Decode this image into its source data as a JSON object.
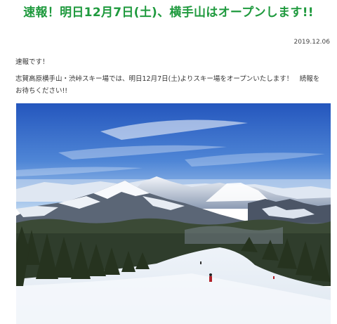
{
  "article": {
    "title": "速報！明日12月7日(土)、横手山はオープンします!!",
    "date": "2019.12.06",
    "lead": "速報です！",
    "body": "志賀高原横手山・渋峠スキー場では、明日12月7日(土)よりスキー場をオープンいたします！　続報をお待ちください!!",
    "photo": {
      "subject": "ski-slope-photo",
      "colors": {
        "sky_top": "#2a5fc4",
        "sky_bottom": "#9fc3ea",
        "snow": "#f4f7fb",
        "forest": "#2f3d2c",
        "title_green": "#1f9a3e"
      }
    }
  }
}
